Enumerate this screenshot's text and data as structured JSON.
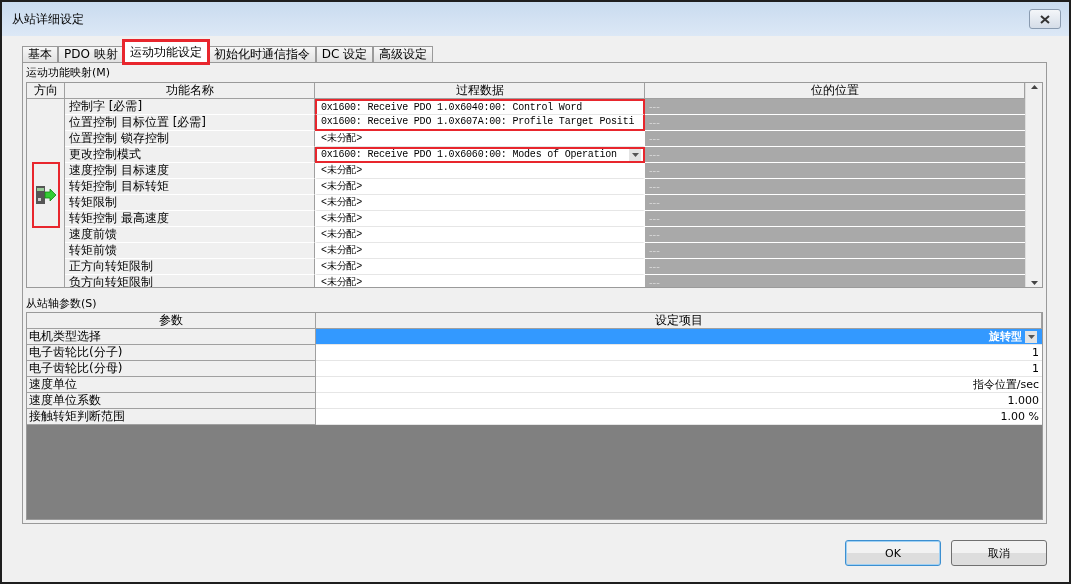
{
  "window": {
    "title": "从站详细设定"
  },
  "tabs": [
    {
      "label": "基本",
      "selected": false,
      "highlighted": false
    },
    {
      "label": "PDO 映射",
      "selected": false,
      "highlighted": false
    },
    {
      "label": "运动功能设定",
      "selected": true,
      "highlighted": true
    },
    {
      "label": "初始化时通信指令",
      "selected": false,
      "highlighted": false
    },
    {
      "label": "DC 设定",
      "selected": false,
      "highlighted": false
    },
    {
      "label": "高级设定",
      "selected": false,
      "highlighted": false
    }
  ],
  "mapping": {
    "label": "运动功能映射(M)",
    "columns": [
      "方向",
      "功能名称",
      "过程数据",
      "位的位置"
    ],
    "direction_highlighted": true,
    "rows": [
      {
        "name": "控制字 [必需]",
        "process_data": "0x1600: Receive PDO 1.0x6040:00: Control Word",
        "kind": "text",
        "highlighted": true,
        "bit_position": "---"
      },
      {
        "name": "位置控制 目标位置 [必需]",
        "process_data": "0x1600: Receive PDO 1.0x607A:00: Profile Target Positi",
        "kind": "text",
        "highlighted": true,
        "bit_position": "---"
      },
      {
        "name": "位置控制 锁存控制",
        "process_data": "<未分配>",
        "kind": "text",
        "highlighted": false,
        "bit_position": "---"
      },
      {
        "name": "更改控制模式",
        "process_data": "0x1600: Receive PDO 1.0x6060:00: Modes of Operation",
        "kind": "dropdown",
        "highlighted": true,
        "bit_position": "---"
      },
      {
        "name": "速度控制 目标速度",
        "process_data": "<未分配>",
        "kind": "text",
        "highlighted": false,
        "bit_position": "---"
      },
      {
        "name": "转矩控制 目标转矩",
        "process_data": "<未分配>",
        "kind": "text",
        "highlighted": false,
        "bit_position": "---"
      },
      {
        "name": "转矩限制",
        "process_data": "<未分配>",
        "kind": "text",
        "highlighted": false,
        "bit_position": "---"
      },
      {
        "name": "转矩控制 最高速度",
        "process_data": "<未分配>",
        "kind": "text",
        "highlighted": false,
        "bit_position": "---"
      },
      {
        "name": "速度前馈",
        "process_data": "<未分配>",
        "kind": "text",
        "highlighted": false,
        "bit_position": "---"
      },
      {
        "name": "转矩前馈",
        "process_data": "<未分配>",
        "kind": "text",
        "highlighted": false,
        "bit_position": "---"
      },
      {
        "name": "正方向转矩限制",
        "process_data": "<未分配>",
        "kind": "text",
        "highlighted": false,
        "bit_position": "---"
      },
      {
        "name": "负方向转矩限制",
        "process_data": "<未分配>",
        "kind": "text",
        "highlighted": false,
        "bit_position": "---"
      }
    ]
  },
  "axis_params": {
    "label": "从站轴参数(S)",
    "columns": [
      "参数",
      "设定项目"
    ],
    "rows": [
      {
        "name": "电机类型选择",
        "value": "旋转型",
        "kind": "dropdown",
        "selected": true
      },
      {
        "name": "电子齿轮比(分子)",
        "value": "1",
        "kind": "text",
        "selected": false
      },
      {
        "name": "电子齿轮比(分母)",
        "value": "1",
        "kind": "text",
        "selected": false
      },
      {
        "name": "速度单位",
        "value": "指令位置/sec",
        "kind": "text",
        "selected": false
      },
      {
        "name": "速度单位系数",
        "value": "1.000",
        "kind": "text",
        "selected": false
      },
      {
        "name": "接触转矩判断范围",
        "value": "1.00 %",
        "kind": "text",
        "selected": false
      }
    ]
  },
  "buttons": [
    {
      "label": "OK",
      "default": true
    },
    {
      "label": "取消",
      "default": false
    }
  ]
}
